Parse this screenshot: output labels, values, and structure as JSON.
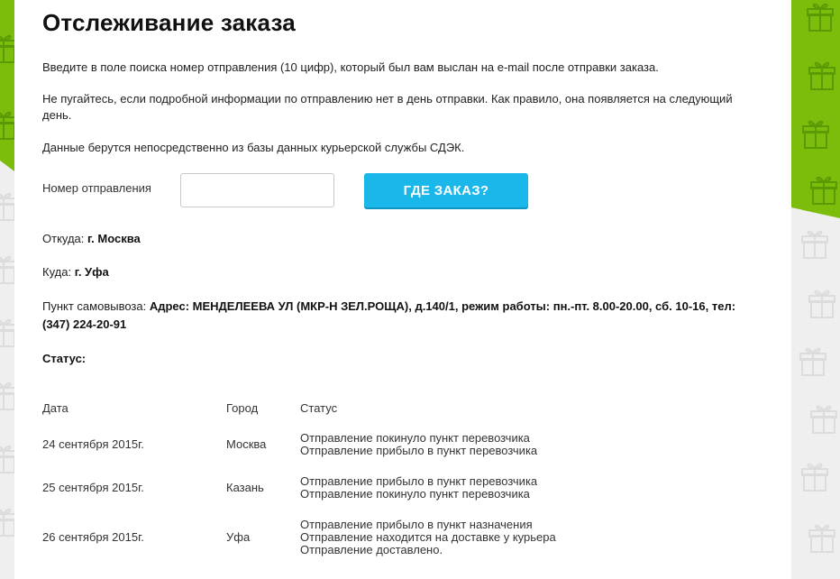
{
  "page_title": "Отслеживание заказа",
  "intro": {
    "p1": "Введите в поле поиска номер отправления (10 цифр), который был вам выслан на e-mail после отправки заказа.",
    "p2": "Не пугайтесь, если подробной информации по отправлению нет в день отправки. Как правило, она появляется на следующий день.",
    "p3": "Данные берутся непосредственно из базы данных курьерской службы СДЭК."
  },
  "search": {
    "label": "Номер отправления",
    "value": "",
    "placeholder": "",
    "button_label": "ГДЕ ЗАКАЗ?"
  },
  "shipment": {
    "from_label": "Откуда:",
    "from_value": "г. Москва",
    "to_label": "Куда:",
    "to_value": "г. Уфа",
    "pickup_label": "Пункт самовывоза:",
    "pickup_value": "Адрес: МЕНДЕЛЕЕВА УЛ (МКР-Н ЗЕЛ.РОЩА), д.140/1, режим работы: пн.-пт. 8.00-20.00, сб. 10-16, тел: (347) 224-20-91",
    "status_label": "Статус:"
  },
  "history": {
    "headers": {
      "date": "Дата",
      "city": "Город",
      "status": "Статус"
    },
    "rows": [
      {
        "date": "24 сентября 2015г.",
        "city": "Москва",
        "statuses": [
          "Отправление покинуло пункт перевозчика",
          "Отправление прибыло в пункт перевозчика"
        ]
      },
      {
        "date": "25 сентября 2015г.",
        "city": "Казань",
        "statuses": [
          "Отправление прибыло в пункт перевозчика",
          "Отправление покинуло пункт перевозчика"
        ]
      },
      {
        "date": "26 сентября 2015г.",
        "city": "Уфа",
        "statuses": [
          "Отправление прибыло в пункт назначения",
          "Отправление находится на доставке у курьера",
          "Отправление доставлено."
        ]
      }
    ]
  },
  "colors": {
    "accent_green": "#7cbc0a",
    "button_blue": "#1ab7ea",
    "background_gray": "#efefef"
  },
  "icons": [
    "gift-icon"
  ]
}
